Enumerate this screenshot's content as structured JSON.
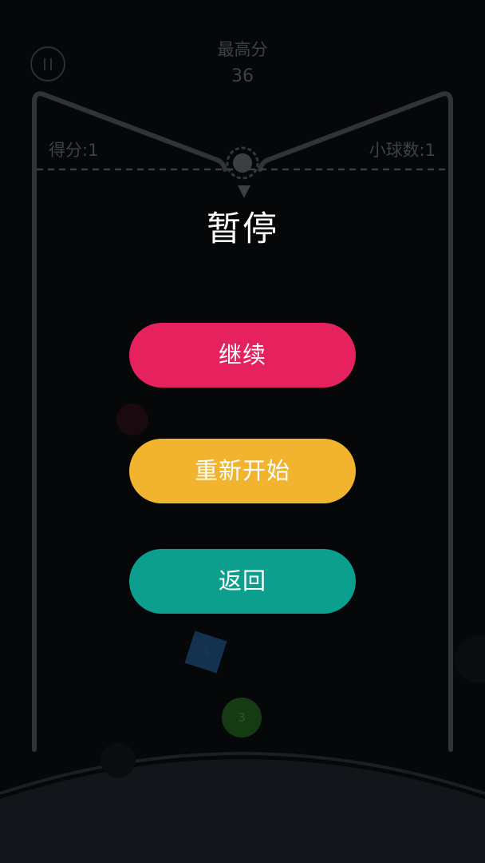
{
  "hud": {
    "best_score_label": "最高分",
    "best_score_value": "36",
    "score_label": "得分:1",
    "balls_label": "小球数:1"
  },
  "board": {
    "blocks": [
      {
        "shape": "square",
        "number": "3",
        "color": "#14324f"
      },
      {
        "shape": "circle",
        "number": "3",
        "color": "#163a14"
      }
    ]
  },
  "pause_menu": {
    "title": "暂停",
    "resume_label": "继续",
    "restart_label": "重新开始",
    "back_label": "返回"
  },
  "colors": {
    "background": "#050709",
    "resume": "#e6225e",
    "restart": "#f2b42f",
    "back": "#0c9f8d"
  }
}
